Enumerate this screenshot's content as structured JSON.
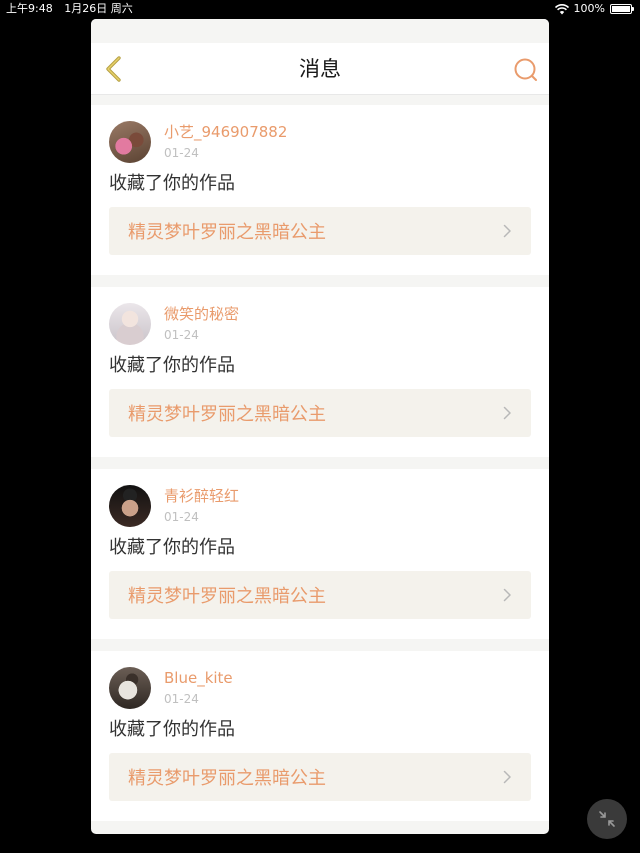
{
  "status_bar": {
    "time": "上午9:48",
    "date": "1月26日 周六",
    "battery": "100%",
    "battery_level": 1.0
  },
  "nav": {
    "title": "消息",
    "back_icon": "chevron-left-icon",
    "search_icon": "search-icon"
  },
  "colors": {
    "accent": "#e99b6c",
    "back_icon": "#b5a045",
    "link_bg": "#f4f2ec",
    "page_bg": "#f5f5f3"
  },
  "notifications": [
    {
      "username": "小艺_946907882",
      "date": "01-24",
      "message": "收藏了你的作品",
      "work_title": "精灵梦叶罗丽之黑暗公主",
      "avatar_icon": "avatar-girls-photo"
    },
    {
      "username": "微笑的秘密",
      "date": "01-24",
      "message": "收藏了你的作品",
      "work_title": "精灵梦叶罗丽之黑暗公主",
      "avatar_icon": "avatar-anime-girl"
    },
    {
      "username": "青衫醉轻红",
      "date": "01-24",
      "message": "收藏了你的作品",
      "work_title": "精灵梦叶罗丽之黑暗公主",
      "avatar_icon": "avatar-dark-portrait"
    },
    {
      "username": "Blue_kite",
      "date": "01-24",
      "message": "收藏了你的作品",
      "work_title": "精灵梦叶罗丽之黑暗公主",
      "avatar_icon": "avatar-mirror-selfie"
    }
  ],
  "float_button_icon": "collapse-arrows-icon"
}
